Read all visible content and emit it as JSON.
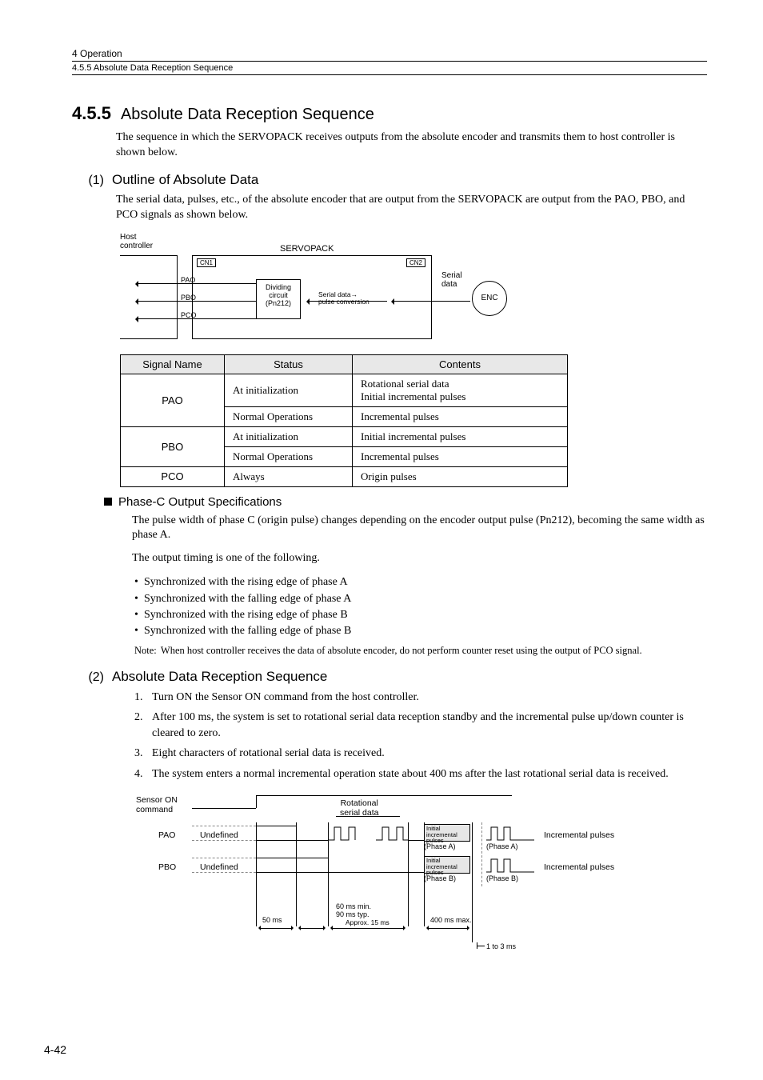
{
  "header": {
    "chapter": "4  Operation",
    "subsection": "4.5.5  Absolute Data Reception Sequence"
  },
  "section": {
    "num": "4.5.5",
    "title": "Absolute Data Reception Sequence"
  },
  "intro": "The sequence in which the SERVOPACK receives outputs from the absolute encoder and transmits them to host controller is shown below.",
  "sub1": {
    "num": "(1)",
    "title": "Outline of Absolute Data"
  },
  "sub1_text": "The serial data, pulses, etc., of the absolute encoder that are output from the SERVOPACK are output from the PAO, PBO, and PCO signals as shown below.",
  "diag1": {
    "host": "Host\ncontroller",
    "servopack": "SERVOPACK",
    "cn1": "CN1",
    "cn2": "CN2",
    "dividing": "Dividing\ncircuit\n(Pn212)",
    "conv": "Serial data→\npulse conversion",
    "serial": "Serial\ndata",
    "enc": "ENC",
    "pao": "PAO",
    "pbo": "PBO",
    "pco": "PCO"
  },
  "table": {
    "headers": [
      "Signal Name",
      "Status",
      "Contents"
    ],
    "rows": [
      {
        "name": "PAO",
        "status1": "At initialization",
        "contents1": "Rotational serial data\nInitial incremental pulses",
        "status2": "Normal Operations",
        "contents2": "Incremental pulses"
      },
      {
        "name": "PBO",
        "status1": "At initialization",
        "contents1": "Initial incremental pulses",
        "status2": "Normal Operations",
        "contents2": "Incremental pulses"
      },
      {
        "name": "PCO",
        "status1": "Always",
        "contents1": "Origin pulses"
      }
    ]
  },
  "phasec": {
    "title": "Phase-C Output Specifications",
    "p1": "The pulse width of phase C (origin pulse) changes depending on the encoder output pulse (Pn212), becoming the same width as phase A.",
    "p2": "The output timing is one of the following.",
    "bullets": [
      "Synchronized with the rising edge of phase A",
      "Synchronized with the falling edge of phase A",
      "Synchronized with the rising edge of phase B",
      "Synchronized with the falling edge of phase B"
    ],
    "note_label": "Note:",
    "note": "When host controller receives the data of absolute encoder, do not perform counter reset using the output of PCO signal."
  },
  "sub2": {
    "num": "(2)",
    "title": "Absolute Data Reception Sequence"
  },
  "steps": [
    "Turn ON the Sensor ON command from the host controller.",
    "After 100 ms, the system is set to rotational serial data reception standby and the incremental pulse up/down counter is cleared to zero.",
    "Eight characters of rotational serial data is received.",
    "The system enters a normal incremental operation state about 400 ms after the last rotational serial data is received."
  ],
  "diag2": {
    "sensor_on": "Sensor ON\ncommand",
    "rotational": "Rotational\nserial data",
    "pao": "PAO",
    "pbo": "PBO",
    "undefined": "Undefined",
    "iip": "Initial\nincremental\npulses",
    "phase_a": "(Phase A)",
    "phase_b": "(Phase B)",
    "inc_pulses": "Incremental pulses",
    "t50": "50 ms",
    "t60": "60 ms min.\n90 ms typ.",
    "t15": "Approx. 15 ms",
    "t400": "400 ms max.",
    "t1_3": "1 to 3 ms"
  },
  "page_num": "4-42"
}
